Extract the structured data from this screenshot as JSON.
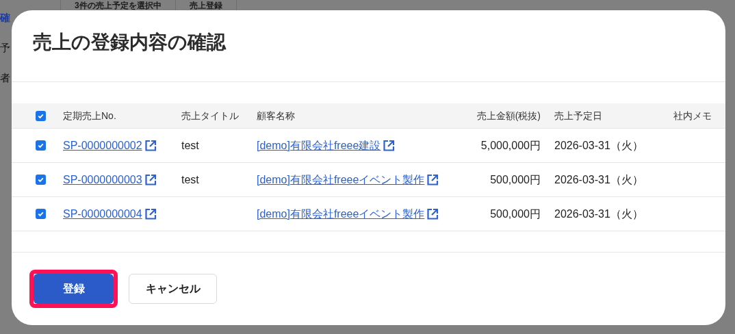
{
  "background": {
    "header_cells": [
      "3件の売上予定を選択中",
      "売上登録"
    ],
    "side_texts": [
      {
        "text": "確",
        "kind": "link"
      },
      {
        "text": "予",
        "kind": "plain"
      },
      {
        "text": "者",
        "kind": "plain"
      }
    ]
  },
  "dialog": {
    "title": "売上の登録内容の確認",
    "table": {
      "select_all_checked": true,
      "columns": [
        "定期売上No.",
        "売上タイトル",
        "顧客名称",
        "売上金額(税抜)",
        "売上予定日",
        "社内メモ"
      ],
      "rows": [
        {
          "checked": true,
          "number": "SP-0000000002",
          "title": "test",
          "customer": "[demo]有限会社freee建設",
          "amount": "5,000,000円",
          "date": "2026-03-31（火）"
        },
        {
          "checked": true,
          "number": "SP-0000000003",
          "title": "test",
          "customer": "[demo]有限会社freeeイベント製作",
          "amount": "500,000円",
          "date": "2026-03-31（火）"
        },
        {
          "checked": true,
          "number": "SP-0000000004",
          "customer": "[demo]有限会社freeeイベント製作",
          "amount": "500,000円",
          "date": "2026-03-31（火）"
        }
      ]
    },
    "buttons": [
      {
        "label": "登録",
        "kind": "primary",
        "highlighted": true
      },
      {
        "label": "キャンセル",
        "kind": "secondary",
        "highlighted": false
      }
    ]
  }
}
